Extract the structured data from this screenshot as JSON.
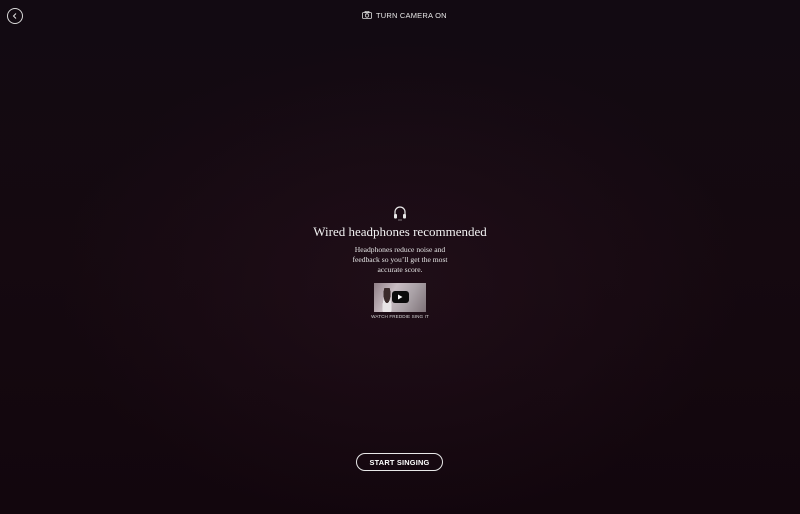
{
  "header": {
    "back_icon": "chevron-left-icon",
    "camera_icon": "camera-icon",
    "camera_label": "TURN CAMERA ON"
  },
  "main": {
    "icon": "headphones-icon",
    "title": "Wired headphones recommended",
    "description": "Headphones reduce noise and feedback so you’ll get the most accurate score.",
    "video": {
      "play_icon": "play-icon",
      "caption": "WATCH FREDDIE SING IT"
    }
  },
  "footer": {
    "start_label": "START SINGING"
  },
  "colors": {
    "background": "#110810",
    "text": "#ffffff",
    "play_button": "#0b0b0b"
  }
}
